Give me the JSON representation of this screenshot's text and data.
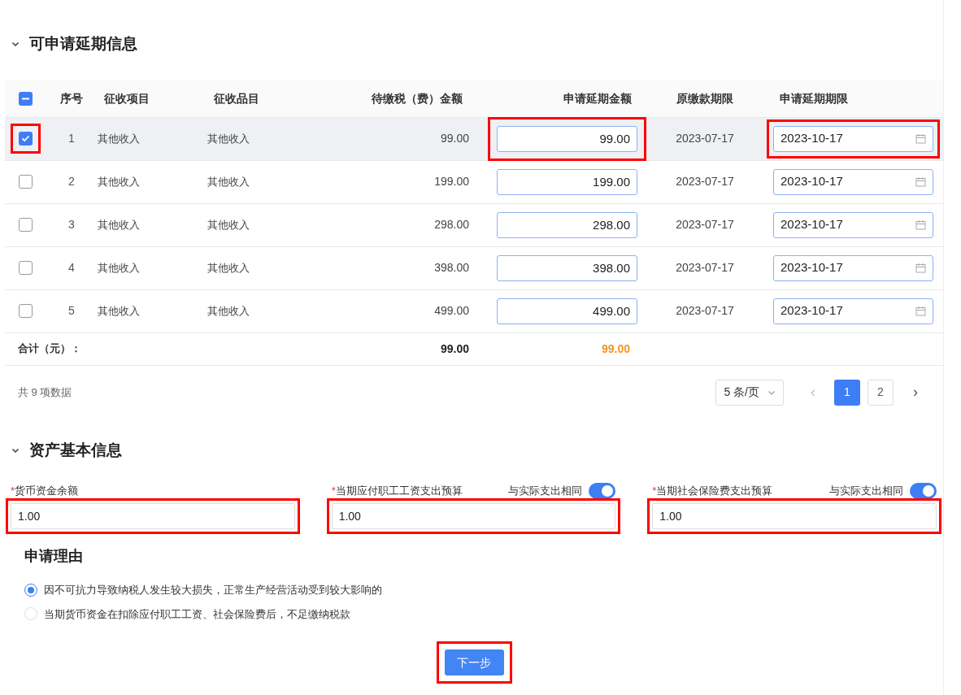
{
  "section_1": {
    "title": "可申请延期信息",
    "expanded": true
  },
  "table": {
    "select_all": {
      "indeterminate": true
    },
    "columns": [
      "序号",
      "征收项目",
      "征收品目",
      "待缴税（费）金额",
      "申请延期金额",
      "原缴款期限",
      "申请延期期限"
    ],
    "rows": [
      {
        "selected": true,
        "highlighted": true,
        "no": "1",
        "item": "其他收入",
        "subitem": "其他收入",
        "due": "99.00",
        "amount": "99.00",
        "original_deadline": "2023-07-17",
        "deadline": "2023-10-17"
      },
      {
        "selected": false,
        "highlighted": false,
        "no": "2",
        "item": "其他收入",
        "subitem": "其他收入",
        "due": "199.00",
        "amount": "199.00",
        "original_deadline": "2023-07-17",
        "deadline": "2023-10-17"
      },
      {
        "selected": false,
        "highlighted": false,
        "no": "3",
        "item": "其他收入",
        "subitem": "其他收入",
        "due": "298.00",
        "amount": "298.00",
        "original_deadline": "2023-07-17",
        "deadline": "2023-10-17"
      },
      {
        "selected": false,
        "highlighted": false,
        "no": "4",
        "item": "其他收入",
        "subitem": "其他收入",
        "due": "398.00",
        "amount": "398.00",
        "original_deadline": "2023-07-17",
        "deadline": "2023-10-17"
      },
      {
        "selected": false,
        "highlighted": false,
        "no": "5",
        "item": "其他收入",
        "subitem": "其他收入",
        "due": "499.00",
        "amount": "499.00",
        "original_deadline": "2023-07-17",
        "deadline": "2023-10-17"
      }
    ],
    "total": {
      "label": "合计（元）：",
      "due": "99.00",
      "amount": "99.00"
    }
  },
  "pagination": {
    "summary": "共 9 项数据",
    "page_size": "5 条/页",
    "prev": "‹",
    "next": "›",
    "pages": [
      {
        "label": "1",
        "selected": true
      },
      {
        "label": "2",
        "selected": false
      }
    ]
  },
  "section_2": {
    "title": "资产基本信息",
    "expanded": true
  },
  "asset_fields": [
    {
      "required_mark": "*",
      "label": "货币资金余额",
      "value": "1.00",
      "highlighted": true
    },
    {
      "required_mark": "*",
      "label": "当期应付职工工资支出预算",
      "value": "1.00",
      "highlighted": true,
      "toggle": {
        "label": "与实际支出相同",
        "on": true
      }
    },
    {
      "required_mark": "*",
      "label": "当期社会保险费支出预算",
      "value": "1.00",
      "highlighted": true,
      "toggle": {
        "label": "与实际支出相同",
        "on": true
      }
    }
  ],
  "reason": {
    "title": "申请理由",
    "options": [
      {
        "label": "因不可抗力导致纳税人发生较大损失，正常生产经营活动受到较大影响的",
        "selected": true
      },
      {
        "label": "当期货币资金在扣除应付职工工资、社会保险费后，不足缴纳税款",
        "selected": false
      }
    ]
  },
  "next_button": {
    "label": "下一步",
    "highlighted": true
  }
}
